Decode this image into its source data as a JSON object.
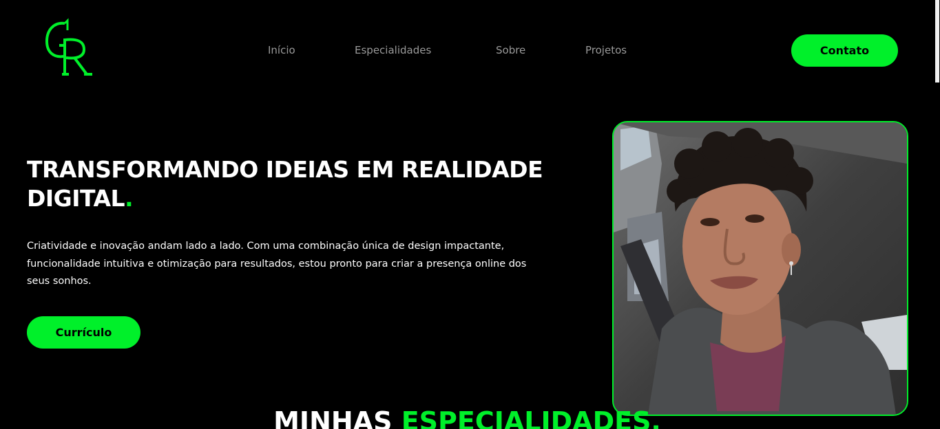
{
  "header": {
    "logo_alt": "GR",
    "nav": {
      "inicio": "Início",
      "especialidades": "Especialidades",
      "sobre": "Sobre",
      "projetos": "Projetos"
    },
    "contact_label": "Contato"
  },
  "hero": {
    "title_line": "TRANSFORMANDO IDEIAS EM REALIDADE DIGITAL",
    "title_dot": ".",
    "paragraph": "Criatividade e inovação andam lado a lado. Com uma combinação única de design impactante, funcionalidade intuitiva e otimização para resultados, estou pronto para criar a presença online dos seus sonhos.",
    "cv_label": "Currículo",
    "photo_alt": "profile photo"
  },
  "section": {
    "title_white": "MINHAS ",
    "title_green": "ESPECIALIDADES."
  },
  "colors": {
    "accent": "#00f02a",
    "background": "#000000",
    "nav_text": "#9a9a9a"
  }
}
